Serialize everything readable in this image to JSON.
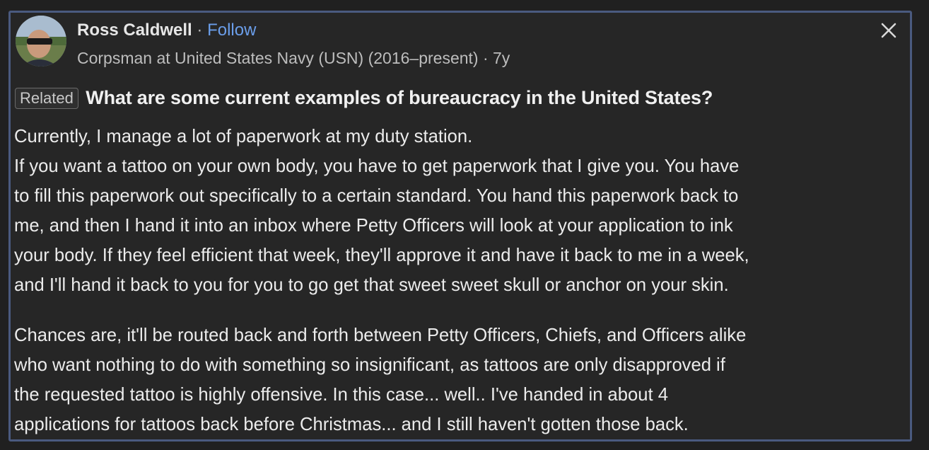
{
  "author": {
    "name": "Ross Caldwell",
    "separator": "·",
    "follow_label": "Follow",
    "credential": "Corpsman at United States Navy (USN) (2016–present) · 7y"
  },
  "question": {
    "badge": "Related",
    "title": "What are some current examples of bureaucracy in the United States?"
  },
  "answer": {
    "paragraph1_lines": [
      "Currently, I manage a lot of paperwork at my duty station.",
      "If you want a tattoo on your own body, you have to get paperwork that I give you. You have",
      "to fill this paperwork out specifically to a certain standard. You hand this paperwork back to",
      "me, and then I hand it into an inbox where Petty Officers will look at your application to ink",
      "your body. If they feel efficient that week, they'll approve it and have it back to me in a week,",
      "and I'll hand it back to you for you to go get that sweet sweet skull or anchor on your skin."
    ],
    "paragraph2_lines": [
      "Chances are, it'll be routed back and forth between Petty Officers, Chiefs, and Officers alike",
      "who want nothing to do with something so insignificant, as tattoos are only disapproved if",
      "the requested tattoo is highly offensive. In this case... well.. I've handed in about 4",
      "applications for tattoos back before Christmas... and I still haven't gotten those back."
    ]
  },
  "icons": {
    "close": "close-icon",
    "avatar": "avatar"
  },
  "colors": {
    "background": "#202020",
    "card_border": "#4a5a7f",
    "follow": "#6b9eea"
  }
}
